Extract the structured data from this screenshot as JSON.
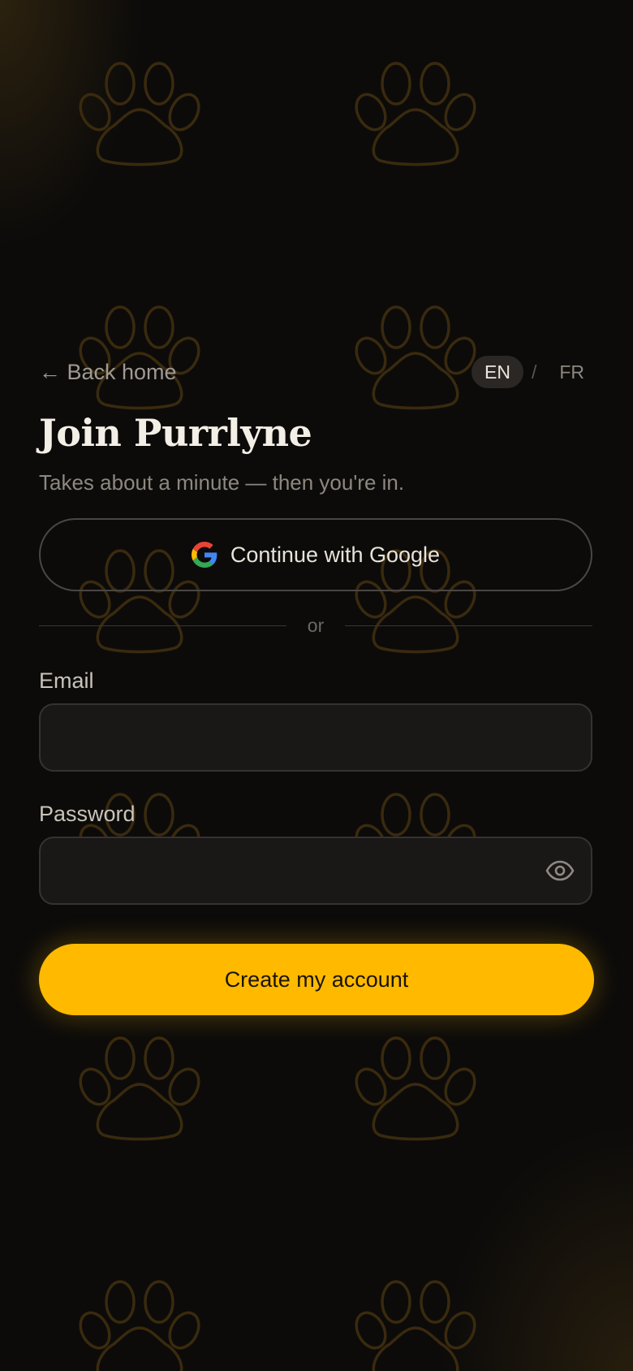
{
  "nav": {
    "back_label": "← Back home"
  },
  "language": {
    "options": [
      "EN",
      "FR"
    ],
    "selected": "EN",
    "separator": "/"
  },
  "header": {
    "title": "Join Purrlyne",
    "subtitle": "Takes about a minute — then you're in."
  },
  "google": {
    "label": "Continue with Google",
    "icon": "google-g-icon"
  },
  "divider": {
    "label": "or"
  },
  "form": {
    "email": {
      "label": "Email",
      "value": "",
      "placeholder": ""
    },
    "password": {
      "label": "Password",
      "value": "",
      "placeholder": "",
      "toggle_icon": "eye-icon"
    }
  },
  "cta": {
    "label": "Create my account"
  },
  "colors": {
    "background": "#0c0b0a",
    "accent": "#ffba00",
    "paw_outline": "#3a2a0e",
    "input_bg": "#1a1816"
  },
  "decor": {
    "pattern_icon": "paw-print-icon"
  }
}
